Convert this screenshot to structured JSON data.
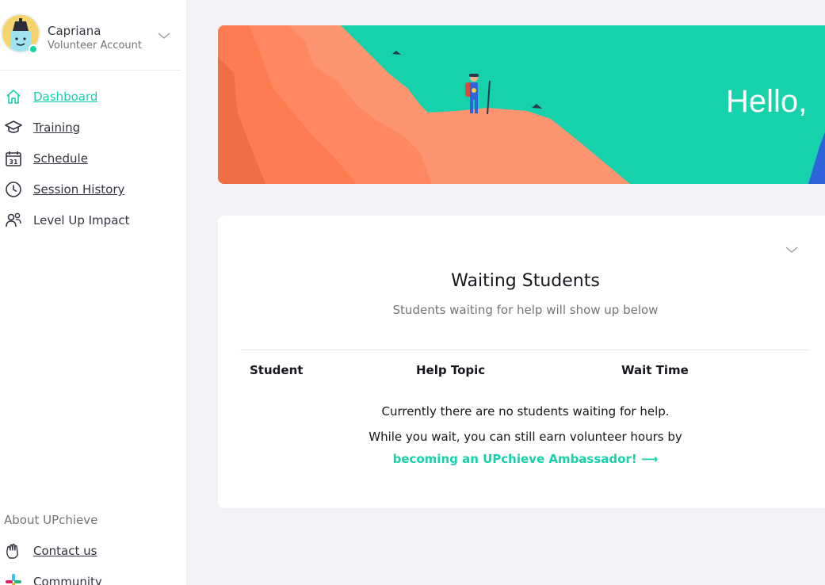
{
  "profile": {
    "name": "Capriana",
    "role": "Volunteer Account"
  },
  "nav": {
    "items": [
      {
        "label": "Dashboard"
      },
      {
        "label": "Training"
      },
      {
        "label": "Schedule"
      },
      {
        "label": "Session History"
      },
      {
        "label": "Level Up Impact"
      }
    ],
    "calendar_icon_text": "31"
  },
  "footer": {
    "about": "About UPchieve",
    "contact": "Contact us",
    "community": "Community"
  },
  "banner": {
    "greeting": "Hello,"
  },
  "waiting": {
    "title": "Waiting Students",
    "subtitle": "Students waiting for help will show up below",
    "columns": [
      "Student",
      "Help Topic",
      "Wait Time"
    ],
    "empty_message": "Currently there are no students waiting for help.",
    "cta_text": "While you wait, you can still earn volunteer hours by",
    "cta_link": "becoming an UPchieve Ambassador! ⟶"
  },
  "colors": {
    "accent": "#16d2aa",
    "banner_orange": "#ff7c52",
    "text": "#343440"
  }
}
